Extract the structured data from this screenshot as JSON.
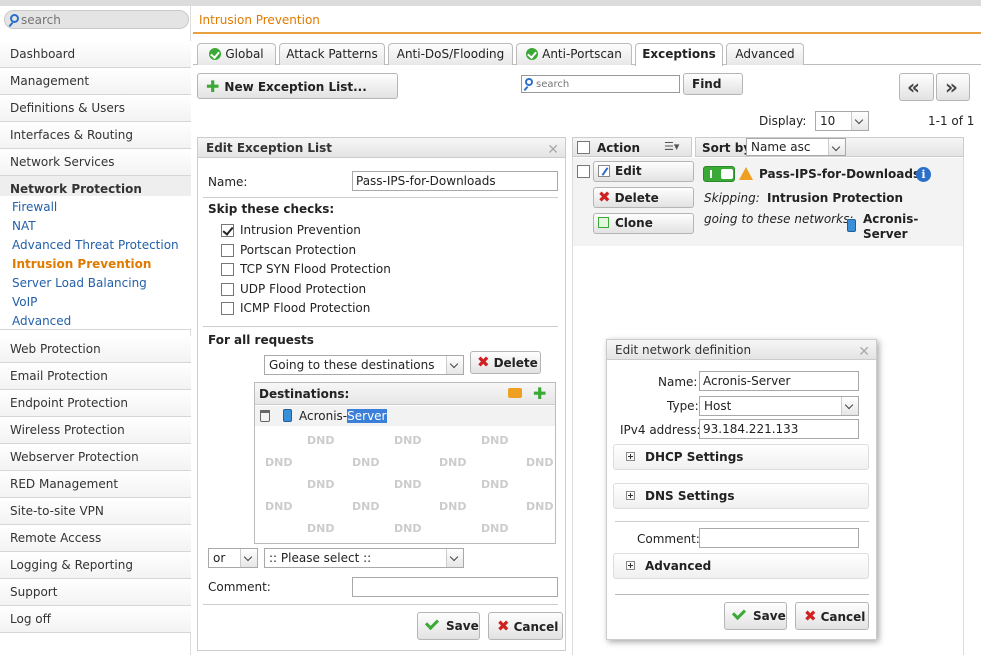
{
  "search": {
    "placeholder": "search"
  },
  "page_title": "Intrusion Prevention",
  "sidebar": {
    "items": [
      "Dashboard",
      "Management",
      "Definitions & Users",
      "Interfaces & Routing",
      "Network Services",
      "Network Protection",
      "Web Protection",
      "Email Protection",
      "Endpoint Protection",
      "Wireless Protection",
      "Webserver Protection",
      "RED Management",
      "Site-to-site VPN",
      "Remote Access",
      "Logging & Reporting",
      "Support",
      "Log off"
    ],
    "subitems": [
      "Firewall",
      "NAT",
      "Advanced Threat Protection",
      "Intrusion Prevention",
      "Server Load Balancing",
      "VoIP",
      "Advanced"
    ]
  },
  "tabs": [
    "Global",
    "Attack Patterns",
    "Anti-DoS/Flooding",
    "Anti-Portscan",
    "Exceptions",
    "Advanced"
  ],
  "toolbar": {
    "new_label": "New Exception List...",
    "search_placeholder": "search",
    "find_label": "Find",
    "prev": "«",
    "next": "»"
  },
  "display": {
    "label": "Display:",
    "value": "10",
    "range": "1-1 of 1"
  },
  "edit_panel": {
    "title": "Edit Exception List",
    "close": "✕",
    "name_label": "Name:",
    "name_value": "Pass-IPS-for-Downloads",
    "skip_label": "Skip these checks:",
    "checks": [
      {
        "label": "Intrusion Prevention",
        "checked": true
      },
      {
        "label": "Portscan Protection",
        "checked": false
      },
      {
        "label": "TCP SYN Flood Protection",
        "checked": false
      },
      {
        "label": "UDP Flood Protection",
        "checked": false
      },
      {
        "label": "ICMP Flood Protection",
        "checked": false
      }
    ],
    "for_all_label": "For all requests",
    "dest_select": "Going to these destinations",
    "delete_label": "Delete",
    "destinations_title": "Destinations:",
    "dest_item_a": "Acronis-",
    "dest_item_b": "Server",
    "dnd": "DND",
    "or_value": "or",
    "please_select": ":: Please select ::",
    "comment_label": "Comment:",
    "save": "Save",
    "cancel": "Cancel"
  },
  "list": {
    "action_header": "Action",
    "sort_label": "Sort by:",
    "sort_value": "Name asc",
    "edit": "Edit",
    "delete": "Delete",
    "clone": "Clone",
    "entry_name": "Pass-IPS-for-Downloads",
    "skipping_label": "Skipping:",
    "skipping_value": "Intrusion Protection",
    "going_label": "going to these networks:",
    "network_a": "Acronis-",
    "network_b": "Server"
  },
  "net_dialog": {
    "title": "Edit network definition",
    "close": "✕",
    "name_label": "Name:",
    "name_value": "Acronis-Server",
    "type_label": "Type:",
    "type_value": "Host",
    "ipv4_label": "IPv4 address:",
    "ipv4_value": "93.184.221.133",
    "dhcp": "DHCP Settings",
    "dns": "DNS Settings",
    "comment_label": "Comment:",
    "advanced": "Advanced",
    "save": "Save",
    "cancel": "Cancel"
  },
  "colors": {
    "accent": "#e07b00",
    "link": "#2360a8",
    "ok": "#3aa935",
    "danger": "#d02020"
  }
}
